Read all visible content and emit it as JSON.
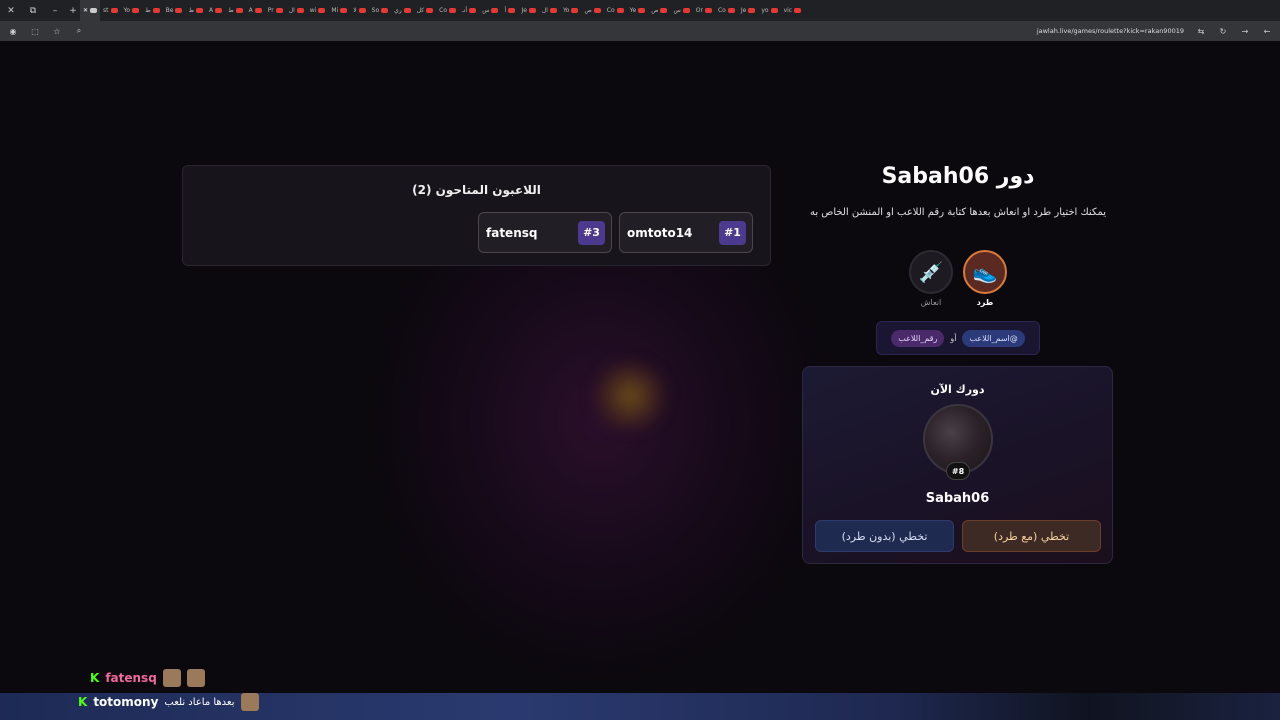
{
  "browser": {
    "tabs": [
      "st",
      "Yo",
      "ط",
      "Be",
      "ط",
      "A",
      "ط",
      "A",
      "Pr",
      "ال",
      "wi",
      "Mi",
      "لا",
      "So",
      "ري",
      "كل",
      "Co",
      "أنـ",
      "س",
      "أ",
      "Je",
      "ال",
      "Yo",
      "ص",
      "Co",
      "Ye",
      "ص",
      "س",
      "Or",
      "Co",
      "Je",
      "yo",
      "vic"
    ],
    "url": "jawlah.live/games/roulette?kick=rakan90019"
  },
  "players_panel": {
    "title": "اللاعبون المتاحون (2)",
    "players": [
      {
        "num": "#1",
        "name": "omtoto14"
      },
      {
        "num": "#3",
        "name": "fatensq"
      }
    ]
  },
  "turn": {
    "title": "دور Sabah06",
    "description": "يمكنك اختيار طرد او انعاش بعدها كتابة رقم اللاعب او المنشن الخاص به"
  },
  "actions": {
    "kick": {
      "label": "طرد",
      "icon": "shoe-icon"
    },
    "revive": {
      "label": "انعاش",
      "icon": "syringe-icon"
    }
  },
  "hint": {
    "name_pill": "@اسم_اللاعب",
    "or": "أو",
    "num_pill": "رقم_اللاعب"
  },
  "current": {
    "label": "دورك الآن",
    "badge": "#8",
    "name": "Sabah06",
    "skip_kick": "تخطي (مع طرد)",
    "skip_nokick": "تخطي (بدون طرد)"
  },
  "chat": [
    {
      "platform": "K",
      "user": "fatensq",
      "color": "#f06a9a",
      "message": ""
    },
    {
      "platform": "K",
      "user": "totomony",
      "color": "#ffffff",
      "message": "بعدها ماعاد نلعب"
    }
  ]
}
